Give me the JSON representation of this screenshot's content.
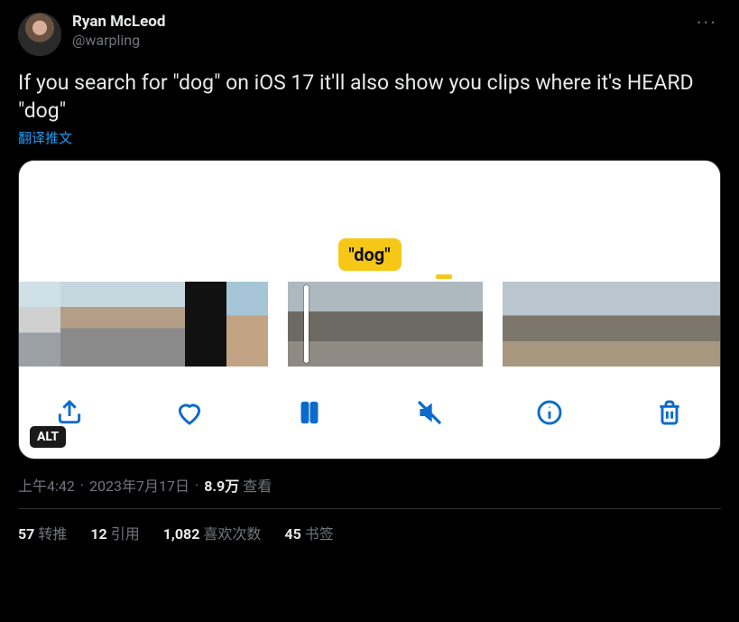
{
  "author": {
    "display_name": "Ryan McLeod",
    "handle": "@warpling"
  },
  "more_glyph": "···",
  "body": "If you search for \"dog\" on iOS 17 it'll also show you clips where it's HEARD \"dog\"",
  "translate_label": "翻译推文",
  "media": {
    "search_tag": "\"dog\"",
    "alt_badge": "ALT",
    "toolbar": {
      "share": "share-icon",
      "heart": "heart-icon",
      "pause": "pause-icon",
      "mute": "mute-icon",
      "info": "info-icon",
      "trash": "trash-icon"
    }
  },
  "meta": {
    "time": "上午4:42",
    "date": "2023年7月17日",
    "views_number": "8.9万",
    "views_label": "查看"
  },
  "stats": {
    "retweets": {
      "n": "57",
      "label": "转推"
    },
    "quotes": {
      "n": "12",
      "label": "引用"
    },
    "likes": {
      "n": "1,082",
      "label": "喜欢次数"
    },
    "bookmarks": {
      "n": "45",
      "label": "书签"
    }
  }
}
